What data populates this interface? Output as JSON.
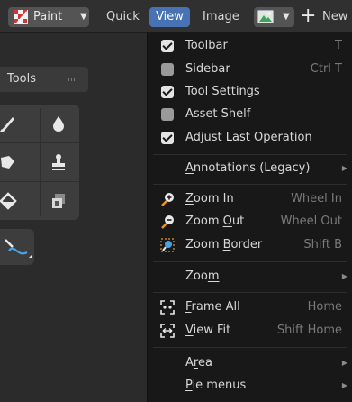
{
  "header": {
    "mode_label": "Paint",
    "menus": {
      "quick": "Quick",
      "view": "View",
      "image": "Image",
      "new": "New"
    },
    "plus_glyph": "+"
  },
  "tools_panel": {
    "title": "Tools"
  },
  "view_menu": {
    "toggles": [
      {
        "label": "Toolbar",
        "shortcut": "T",
        "checked": true
      },
      {
        "label": "Sidebar",
        "shortcut": "Ctrl T",
        "checked": false
      },
      {
        "label": "Tool Settings",
        "shortcut": "",
        "checked": true
      },
      {
        "label": "Asset Shelf",
        "shortcut": "",
        "checked": false
      },
      {
        "label": "Adjust Last Operation",
        "shortcut": "",
        "checked": true
      }
    ],
    "annotations": {
      "pre": "",
      "ul": "A",
      "post": "nnotations (Legacy)"
    },
    "zoom_in": {
      "pre": "",
      "ul": "Z",
      "post": "oom In",
      "shortcut": "Wheel In",
      "icon": "zoom-in-icon"
    },
    "zoom_out": {
      "pre": "Zoom ",
      "ul": "O",
      "post": "ut",
      "shortcut": "Wheel Out",
      "icon": "zoom-out-icon"
    },
    "zoom_border": {
      "pre": "Zoom ",
      "ul": "B",
      "post": "order",
      "shortcut": "Shift B",
      "icon": "zoom-border-icon"
    },
    "zoom_submenu": {
      "pre": "Zoo",
      "ul": "m",
      "post": ""
    },
    "frame_all": {
      "pre": "",
      "ul": "F",
      "post": "rame All",
      "shortcut": "Home",
      "icon": "frame-all-icon"
    },
    "view_fit": {
      "pre": "",
      "ul": "V",
      "post": "iew Fit",
      "shortcut": "Shift Home",
      "icon": "view-fit-icon"
    },
    "area": {
      "pre": "A",
      "ul": "r",
      "post": "ea"
    },
    "pie_menus": {
      "pre": "",
      "ul": "P",
      "post": "ie menus"
    }
  },
  "colors": {
    "menu_bg": "#181818",
    "highlight": "#4772b3",
    "shortcut_text": "#7a7a7a",
    "zoom_icon_accent": "#e8922a"
  }
}
